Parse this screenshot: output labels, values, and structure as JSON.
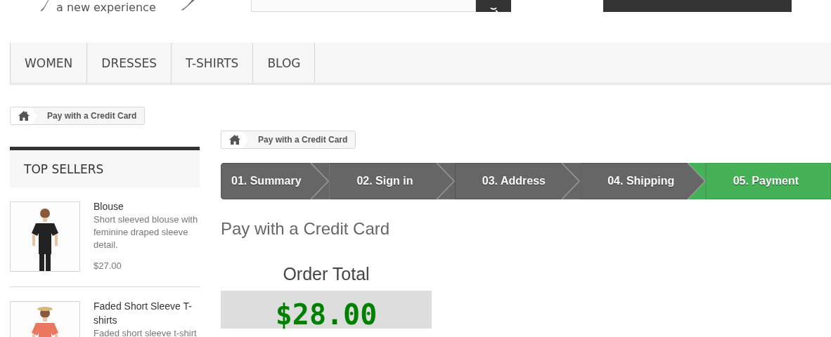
{
  "logo": {
    "tagline": "a new experience"
  },
  "menu": [
    {
      "label": "WOMEN"
    },
    {
      "label": "DRESSES"
    },
    {
      "label": "T-SHIRTS"
    },
    {
      "label": "BLOG"
    }
  ],
  "breadcrumb": {
    "current": "Pay with a Credit Card"
  },
  "top_sellers": {
    "title": "TOP SELLERS",
    "products": [
      {
        "name": "Blouse",
        "description": "Short sleeved blouse with feminine draped sleeve detail.",
        "price": "$27.00"
      },
      {
        "name": "Faded Short Sleeve T-shirts",
        "description": "Faded short sleeve t-shirt"
      }
    ]
  },
  "content_breadcrumb": {
    "current": "Pay with a Credit Card"
  },
  "steps": [
    {
      "label": "01. Summary",
      "selected": false
    },
    {
      "label": "02. Sign in",
      "selected": false
    },
    {
      "label": "03. Address",
      "selected": false
    },
    {
      "label": "04. Shipping",
      "selected": false
    },
    {
      "label": "05. Payment",
      "selected": true
    }
  ],
  "page_title": "Pay with a Credit Card",
  "order_total": {
    "label": "Order Total",
    "amount": "$28.00"
  }
}
